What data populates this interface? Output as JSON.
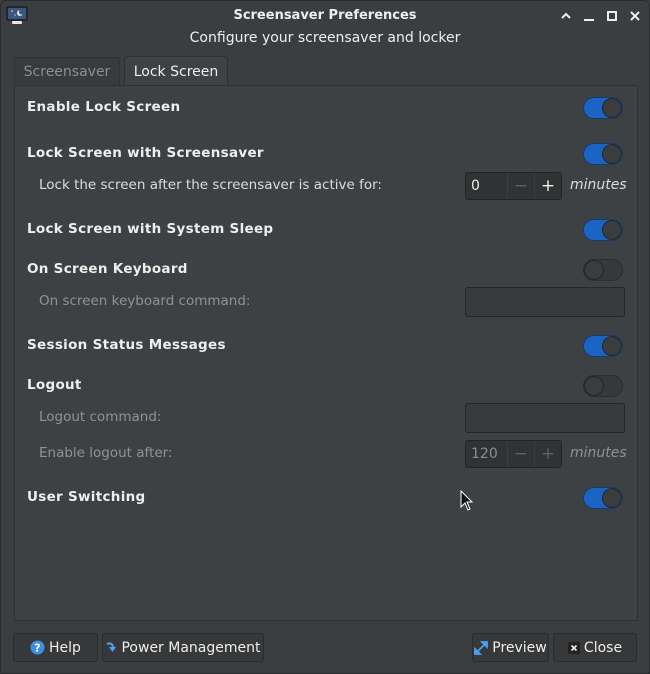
{
  "window": {
    "title": "Screensaver Preferences",
    "subtitle": "Configure your screensaver and locker",
    "app_icon": "monitor-moon-icon",
    "controls": [
      "shade-icon",
      "minimize-icon",
      "maximize-icon",
      "close-icon"
    ]
  },
  "tabs": [
    {
      "label": "Screensaver",
      "active": false
    },
    {
      "label": "Lock Screen",
      "active": true
    }
  ],
  "settings": {
    "enable_lock_screen": {
      "label": "Enable Lock Screen",
      "enabled": true
    },
    "lock_with_screensaver": {
      "label": "Lock Screen with Screensaver",
      "enabled": true,
      "delay_label": "Lock the screen after the screensaver is active for:",
      "delay_value": "0",
      "delay_units": "minutes"
    },
    "lock_with_sleep": {
      "label": "Lock Screen with System Sleep",
      "enabled": true
    },
    "on_screen_keyboard": {
      "label": "On Screen Keyboard",
      "enabled": false,
      "command_label": "On screen keyboard command:",
      "command_value": ""
    },
    "session_status": {
      "label": "Session Status Messages",
      "enabled": true
    },
    "logout": {
      "label": "Logout",
      "enabled": false,
      "command_label": "Logout command:",
      "command_value": "",
      "after_label": "Enable logout after:",
      "after_value": "120",
      "after_units": "minutes"
    },
    "user_switching": {
      "label": "User Switching",
      "enabled": true
    }
  },
  "spin_symbols": {
    "minus": "−",
    "plus": "+"
  },
  "buttons": {
    "help": "Help",
    "power_management": "Power Management",
    "preview": "Preview",
    "close": "Close"
  },
  "colors": {
    "accent": "#1c64c4",
    "background": "#3b3e40",
    "help_icon": "#3d8fe0"
  }
}
